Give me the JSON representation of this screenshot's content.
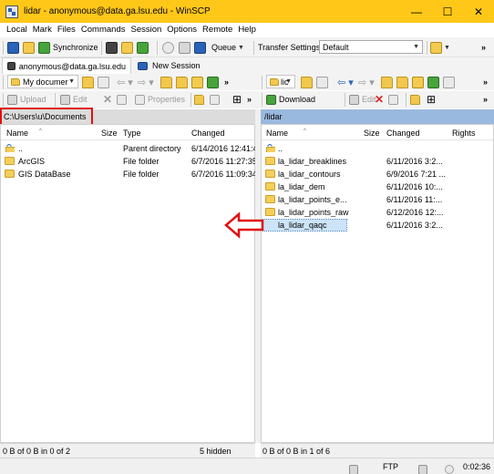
{
  "window": {
    "title": "lidar - anonymous@data.ga.lsu.edu - WinSCP",
    "minimize": "—",
    "maximize": "☐",
    "close": "✕"
  },
  "menu": [
    "Local",
    "Mark",
    "Files",
    "Commands",
    "Session",
    "Options",
    "Remote",
    "Help"
  ],
  "toolbar": {
    "synchronize_label": "Synchronize",
    "queue_label": "Queue",
    "transfer_settings_label": "Transfer Settings",
    "transfer_settings_value": "Default"
  },
  "tabs": {
    "session_tab": "anonymous@data.ga.lsu.edu",
    "new_session": "New Session"
  },
  "left_toolbar": {
    "drive_combo": "My documer",
    "upload": "Upload",
    "edit": "Edit",
    "properties": "Properties"
  },
  "right_toolbar": {
    "dir_combo": "lic",
    "download": "Download",
    "edit": "Edit"
  },
  "left_panel": {
    "path": "C:\\Users\\u\\Documents",
    "columns": [
      "Name",
      "Size",
      "Type",
      "Changed"
    ],
    "rows": [
      {
        "name": "..",
        "size": "",
        "type": "Parent directory",
        "changed": "6/14/2016 12:41:4"
      },
      {
        "name": "ArcGIS",
        "size": "",
        "type": "File folder",
        "changed": "6/7/2016 11:27:35"
      },
      {
        "name": "GIS DataBase",
        "size": "",
        "type": "File folder",
        "changed": "6/7/2016 11:09:34"
      }
    ],
    "status_left": "0 B of 0 B in 0 of 2",
    "status_right": "5 hidden"
  },
  "right_panel": {
    "path": "/lidar",
    "columns": [
      "Name",
      "Size",
      "Changed",
      "Rights"
    ],
    "rows": [
      {
        "name": "..",
        "size": "",
        "changed": "",
        "rights": ""
      },
      {
        "name": "la_lidar_breaklines",
        "size": "",
        "changed": "6/11/2016 3:2...",
        "rights": ""
      },
      {
        "name": "la_lidar_contours",
        "size": "",
        "changed": "6/9/2016 7:21 ...",
        "rights": ""
      },
      {
        "name": "la_lidar_dem",
        "size": "",
        "changed": "6/11/2016 10:...",
        "rights": ""
      },
      {
        "name": "la_lidar_points_e...",
        "size": "",
        "changed": "6/11/2016 11:...",
        "rights": ""
      },
      {
        "name": "la_lidar_points_raw",
        "size": "",
        "changed": "6/12/2016 12:...",
        "rights": ""
      },
      {
        "name": "la_lidar_qaqc",
        "size": "",
        "changed": "6/11/2016 3:2...",
        "rights": ""
      }
    ],
    "status": "0 B of 0 B in 1 of 6"
  },
  "bottom_status": {
    "protocol": "FTP",
    "elapsed": "0:02:36"
  }
}
